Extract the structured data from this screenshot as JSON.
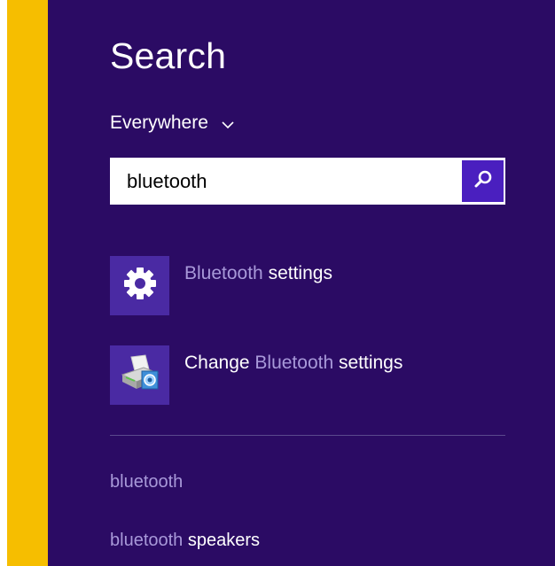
{
  "colors": {
    "accent_bar": "#f6be00",
    "pane_background": "#2b0b64",
    "search_button": "#4a1fbf",
    "tile_background": "#4a2aa3",
    "match_highlight": "#a899d9"
  },
  "charm": {
    "title": "Search",
    "scope_label": "Everywhere",
    "scope_icon": "chevron-down-icon"
  },
  "search": {
    "query": "bluetooth",
    "button_icon": "magnifier-icon"
  },
  "results": [
    {
      "icon": "gear-icon",
      "label_match": "Bluetooth",
      "label_rest": " settings"
    },
    {
      "icon": "control-panel-icon",
      "label_prefix": "Change ",
      "label_match": "Bluetooth",
      "label_rest": " settings"
    }
  ],
  "suggestions": [
    {
      "match": "bluetooth",
      "rest": ""
    },
    {
      "match": "bluetooth",
      "rest": " speakers"
    }
  ]
}
